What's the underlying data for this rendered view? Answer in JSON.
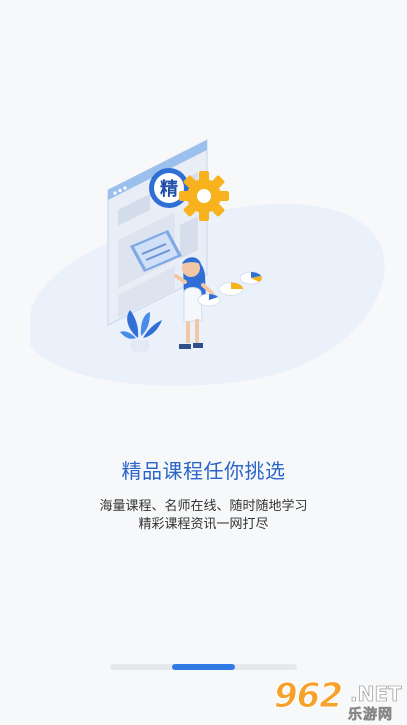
{
  "onboarding": {
    "badge_char": "精",
    "title": "精品课程任你挑选",
    "subtitle_line1": "海量课程、名师在线、随时随地学习",
    "subtitle_line2": "精彩课程资讯一网打尽"
  },
  "pager": {
    "page_count": 3,
    "current_page": 2
  },
  "watermark": {
    "digits": "962",
    "suffix": ".NET",
    "name_cn": "乐游网"
  },
  "colors": {
    "accent": "#2f7be6",
    "title": "#2b64c8",
    "blob": "#eef4fc",
    "gear": "#f7b21e"
  }
}
